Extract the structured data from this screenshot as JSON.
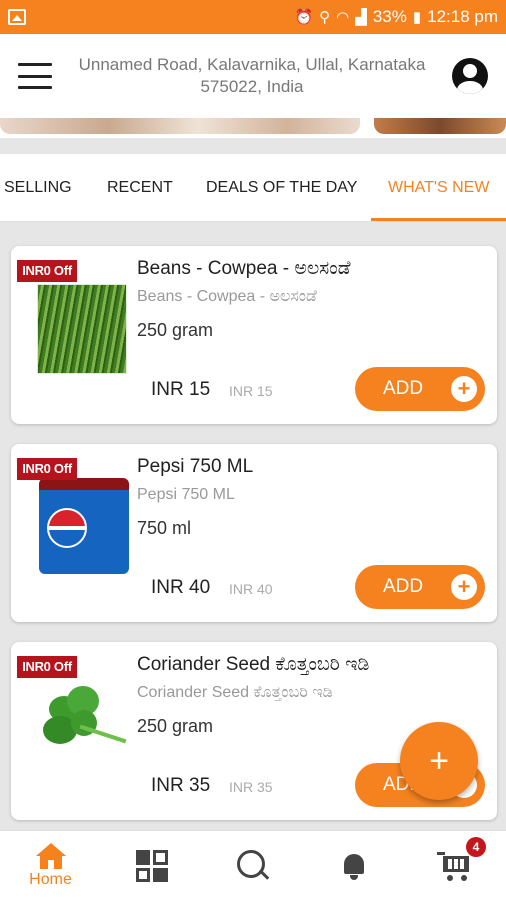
{
  "status_bar": {
    "battery": "33%",
    "time": "12:18 pm"
  },
  "header": {
    "address": "Unnamed Road, Kalavarnika, Ullal, Karnataka 575022, India"
  },
  "tabs": [
    {
      "label": "SELLING",
      "active": false
    },
    {
      "label": "RECENT",
      "active": false
    },
    {
      "label": "DEALS OF THE DAY",
      "active": false
    },
    {
      "label": "WHAT'S NEW",
      "active": true
    }
  ],
  "products": [
    {
      "badge": "INR0 Off",
      "name": "Beans - Cowpea - ಅಲಸಂಡೆ",
      "subtitle": "Beans - Cowpea - ಅಲಸಂಡೆ",
      "quantity": "250 gram",
      "price": "INR 15",
      "mrp": "INR 15",
      "add_label": "ADD"
    },
    {
      "badge": "INR0 Off",
      "name": "Pepsi 750 ML",
      "subtitle": "Pepsi 750 ML",
      "quantity": "750 ml",
      "price": "INR 40",
      "mrp": "INR 40",
      "add_label": "ADD"
    },
    {
      "badge": "INR0 Off",
      "name": "Coriander Seed ಕೊತ್ತಂಬರಿ ಇಡಿ",
      "subtitle": "Coriander Seed ಕೊತ್ತಂಬರಿ ಇಡಿ",
      "quantity": "250 gram",
      "price": "INR 35",
      "mrp": "INR 35",
      "add_label": "ADD"
    }
  ],
  "fab": {
    "symbol": "+"
  },
  "bottom_nav": {
    "home_label": "Home",
    "cart_count": "4"
  },
  "colors": {
    "accent": "#f5821f",
    "badge": "#b5141d"
  },
  "icons": [
    "menu-icon",
    "profile-icon",
    "plus-icon",
    "home-icon",
    "categories-icon",
    "search-icon",
    "bell-icon",
    "cart-icon"
  ]
}
